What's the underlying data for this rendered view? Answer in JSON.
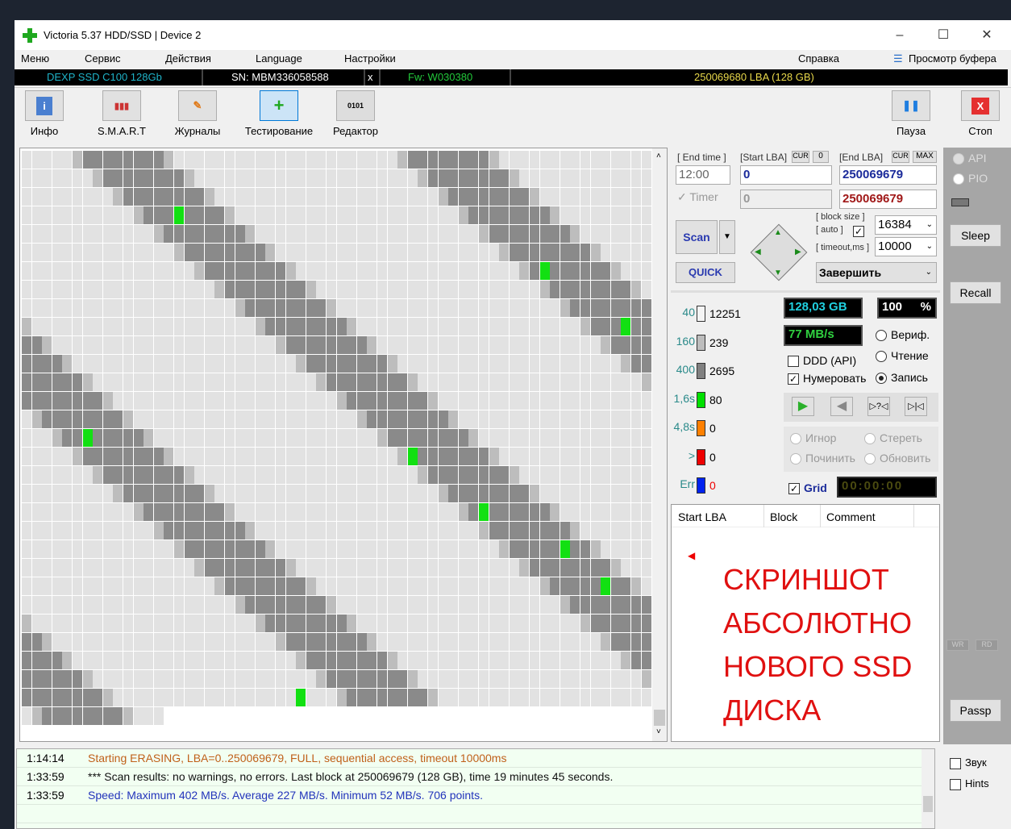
{
  "window": {
    "title": "Victoria 5.37 HDD/SSD | Device 2",
    "minimize": "–",
    "maximize": "☐",
    "close": "✕"
  },
  "menu": [
    "Меню",
    "Сервис",
    "Действия",
    "Language",
    "Настройки",
    "Справка",
    "Просмотр буфера"
  ],
  "device": {
    "model": "DEXP SSD C100 128Gb",
    "serial": "SN: MBM336058588",
    "x": "x",
    "firmware": "Fw: W030380",
    "capacity": "250069680 LBA (128 GB)"
  },
  "toolbar": [
    {
      "label": "Инфо",
      "icon": "i"
    },
    {
      "label": "S.M.A.R.T",
      "icon": "▮▮▮"
    },
    {
      "label": "Журналы",
      "icon": "✎"
    },
    {
      "label": "Тестирование",
      "icon": "+"
    },
    {
      "label": "Редактор",
      "icon": "0101"
    }
  ],
  "toolbar_right": {
    "pause": "Пауза",
    "stop": "Стоп",
    "pause_icon": "❚❚",
    "stop_icon": "X"
  },
  "controls": {
    "end_time_label": "[ End time ]",
    "end_time": "12:00",
    "timer_label": "Timer",
    "start_lba_label": "[Start LBA]",
    "cur": "CUR",
    "zero": "0",
    "start_lba": "0",
    "start_lba2": "0",
    "end_lba_label": "[End LBA]",
    "max": "MAX",
    "end_lba": "250069679",
    "end_lba2": "250069679",
    "block_size_label": "[ block size ]",
    "auto_label": "[ auto ]",
    "timeout_label": "[ timeout,ms ]",
    "block_size": "16384",
    "timeout": "10000",
    "finish": "Завершить",
    "scan": "Scan",
    "quick": "QUICK"
  },
  "stats": {
    "size": "128,03 GB",
    "percent": "100",
    "percent_sign": "%",
    "speed": "77 MB/s",
    "ddd": "DDD (API)",
    "numerate": "Нумеровать",
    "verify": "Вериф.",
    "read": "Чтение",
    "write": "Запись",
    "ignore": "Игнор",
    "erase": "Стереть",
    "repair": "Починить",
    "refresh": "Обновить",
    "grid": "Grid",
    "timer": "00:00:00"
  },
  "legend": [
    {
      "label": "40",
      "count": "12251",
      "color": "#f4f4f4"
    },
    {
      "label": "160",
      "count": "239",
      "color": "#bdbdbd"
    },
    {
      "label": "400",
      "count": "2695",
      "color": "#808080"
    },
    {
      "label": "1,6s",
      "count": "80",
      "color": "#00e000"
    },
    {
      "label": "4,8s",
      "count": "0",
      "color": "#ff8000"
    },
    {
      "label": ">",
      "count": "0",
      "color": "#ee0000"
    },
    {
      "label": "Err",
      "count": "0",
      "color": "#0022ee"
    }
  ],
  "side": {
    "api": "API",
    "pio": "PIO",
    "sleep": "Sleep",
    "recall": "Recall",
    "wr": "WR",
    "rd": "RD",
    "passp": "Passp",
    "sound": "Звук",
    "hints": "Hints"
  },
  "results": {
    "headers": [
      "Start LBA",
      "Block",
      "Comment"
    ],
    "overlay": [
      "СКРИНШОТ",
      "АБСОЛЮТНО",
      "НОВОГО SSD",
      "ДИСКА"
    ]
  },
  "log": [
    {
      "time": "1:14:14",
      "msg": "Starting ERASING, LBA=0..250069679, FULL, sequential access, timeout 10000ms",
      "color": "#c0601a"
    },
    {
      "time": "1:33:59",
      "msg": "*** Scan results: no warnings, no errors. Last block at 250069679 (128 GB), time 19 minutes 45 seconds.",
      "color": "#111111"
    },
    {
      "time": "1:33:59",
      "msg": "Speed: Maximum 402 MB/s. Average 227 MB/s. Minimum 52 MB/s. 706 points.",
      "color": "#2233bb"
    }
  ]
}
